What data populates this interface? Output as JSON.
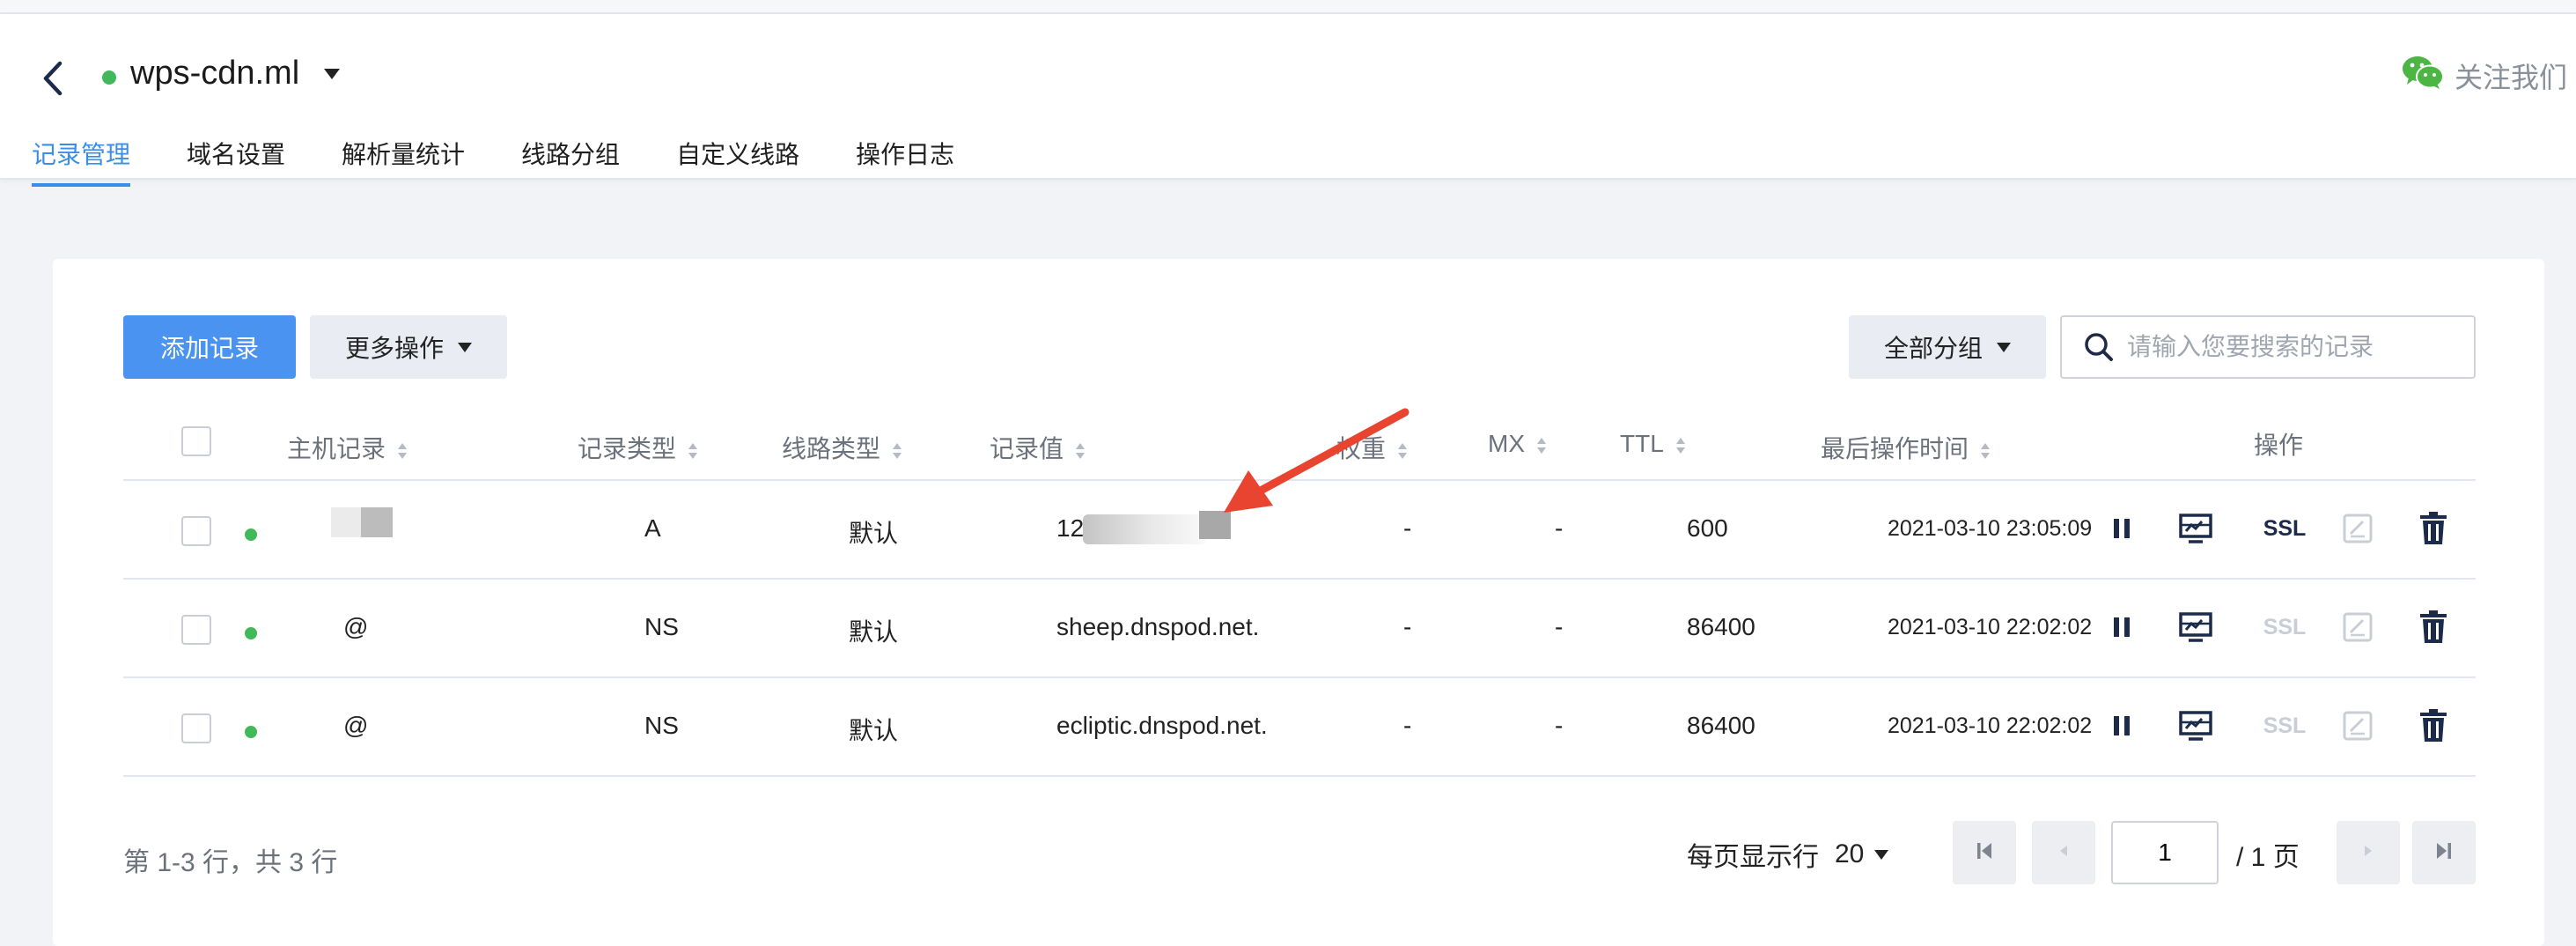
{
  "header": {
    "domain": "wps-cdn.ml",
    "follow_label": "关注我们",
    "tabs": [
      "记录管理",
      "域名设置",
      "解析量统计",
      "线路分组",
      "自定义线路",
      "操作日志"
    ]
  },
  "toolbar": {
    "add_label": "添加记录",
    "more_label": "更多操作",
    "group_label": "全部分组",
    "search_placeholder": "请输入您要搜索的记录"
  },
  "table": {
    "columns": {
      "host": "主机记录",
      "type": "记录类型",
      "line": "线路类型",
      "value": "记录值",
      "weight": "权重",
      "mx": "MX",
      "ttl": "TTL",
      "time": "最后操作时间",
      "ops": "操作"
    },
    "rows": [
      {
        "host": "",
        "type": "A",
        "line": "默认",
        "value": "12",
        "weight": "-",
        "mx": "-",
        "ttl": "600",
        "time": "2021-03-10 23:05:09",
        "ssl": "SSL",
        "ssl_enabled": true
      },
      {
        "host": "@",
        "type": "NS",
        "line": "默认",
        "value": "sheep.dnspod.net.",
        "weight": "-",
        "mx": "-",
        "ttl": "86400",
        "time": "2021-03-10 22:02:02",
        "ssl": "SSL",
        "ssl_enabled": false
      },
      {
        "host": "@",
        "type": "NS",
        "line": "默认",
        "value": "ecliptic.dnspod.net.",
        "weight": "-",
        "mx": "-",
        "ttl": "86400",
        "time": "2021-03-10 22:02:02",
        "ssl": "SSL",
        "ssl_enabled": false
      }
    ]
  },
  "footer": {
    "summary": "第 1-3 行，共 3 行",
    "per_page_label": "每页显示行",
    "per_page_value": "20",
    "current_page": "1",
    "total_pages": "/ 1 页"
  },
  "colors": {
    "accent": "#3a8ee8",
    "primary_button": "#4a93f0",
    "status_green": "#41b85a",
    "annotation_arrow": "#e8442f"
  }
}
